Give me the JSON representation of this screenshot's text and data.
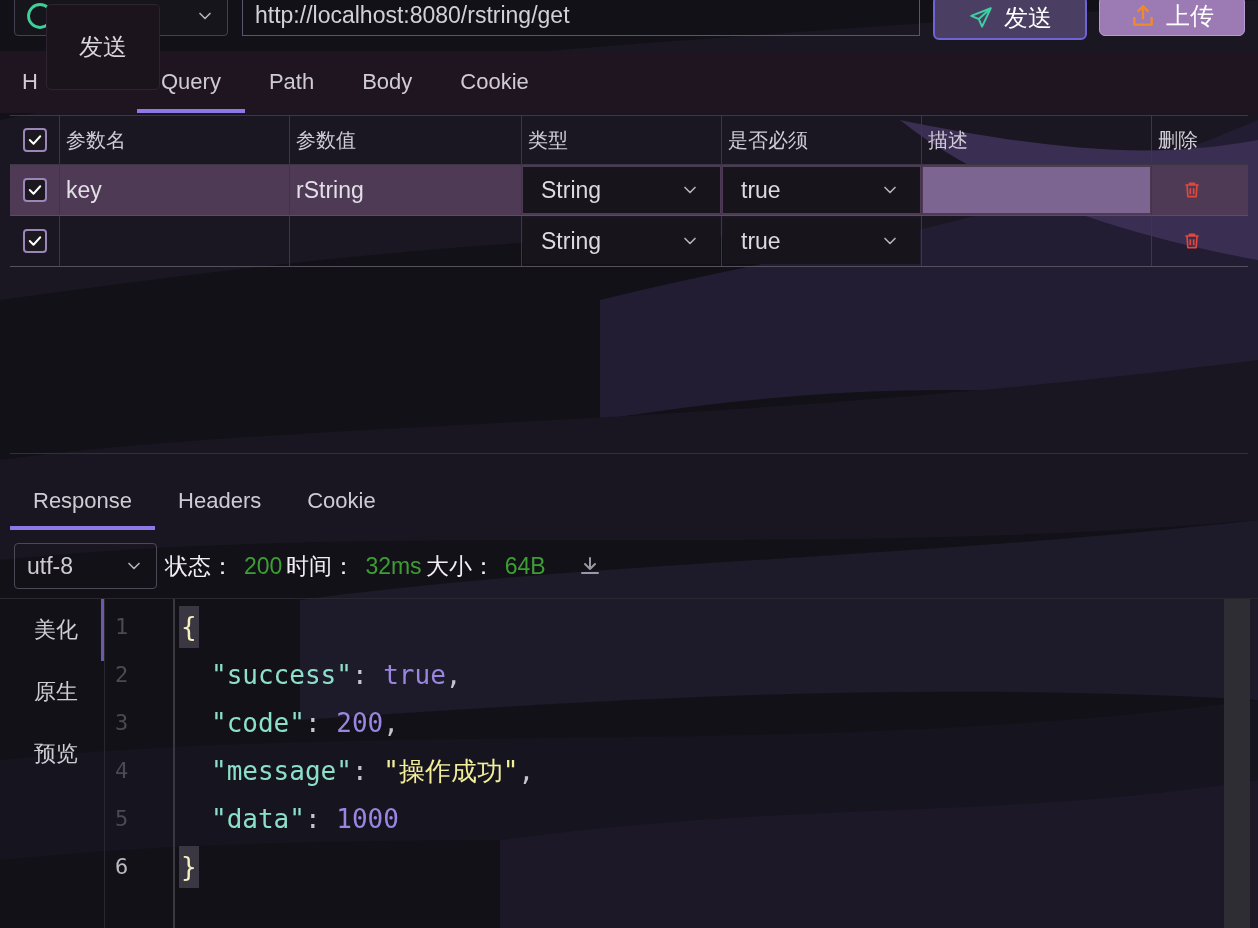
{
  "request_bar": {
    "url": "http://localhost:8080/rstring/get",
    "buttons": [
      {
        "label": "发送",
        "kind": "send"
      },
      {
        "label": "上传",
        "kind": "upload"
      }
    ]
  },
  "tooltip": {
    "text": "发送"
  },
  "request_tabs": [
    {
      "label": "H",
      "selected": false
    },
    {
      "label": "Query",
      "selected": true
    },
    {
      "label": "Path",
      "selected": false
    },
    {
      "label": "Body",
      "selected": false
    },
    {
      "label": "Cookie",
      "selected": false
    }
  ],
  "params_table": {
    "all_checked": true,
    "columns": [
      "参数名",
      "参数值",
      "类型",
      "是否必须",
      "描述",
      "删除"
    ],
    "rows": [
      {
        "checked": true,
        "selected": true,
        "name": "key",
        "value": "rString",
        "type": "String",
        "required": "true"
      },
      {
        "checked": true,
        "selected": false,
        "name": "",
        "value": "",
        "type": "String",
        "required": "true"
      }
    ]
  },
  "response_tabs": [
    {
      "label": "Response",
      "selected": true
    },
    {
      "label": "Headers",
      "selected": false
    },
    {
      "label": "Cookie",
      "selected": false
    }
  ],
  "response_meta": {
    "encoding": "utf-8",
    "items": [
      {
        "label": "状态：",
        "value": "200"
      },
      {
        "label": "时间：",
        "value": "32ms"
      },
      {
        "label": "大小：",
        "value": "64B"
      }
    ]
  },
  "view_modes": [
    {
      "label": "美化",
      "selected": true
    },
    {
      "label": "原生",
      "selected": false
    },
    {
      "label": "预览",
      "selected": false
    }
  ],
  "code": {
    "lines": [
      {
        "number": "1",
        "active": false,
        "tokens": [
          {
            "text": "{",
            "kind": "brace-match"
          }
        ]
      },
      {
        "number": "2",
        "active": false,
        "tokens": [
          {
            "text": "\"success\"",
            "kind": "key"
          },
          {
            "text": ": ",
            "kind": "punct"
          },
          {
            "text": "true",
            "kind": "literal"
          },
          {
            "text": ",",
            "kind": "punct"
          }
        ]
      },
      {
        "number": "3",
        "active": false,
        "tokens": [
          {
            "text": "\"code\"",
            "kind": "key"
          },
          {
            "text": ": ",
            "kind": "punct"
          },
          {
            "text": "200",
            "kind": "literal"
          },
          {
            "text": ",",
            "kind": "punct"
          }
        ]
      },
      {
        "number": "4",
        "active": false,
        "tokens": [
          {
            "text": "\"message\"",
            "kind": "key"
          },
          {
            "text": ": ",
            "kind": "punct"
          },
          {
            "text": "\"操作成功\"",
            "kind": "string"
          },
          {
            "text": ",",
            "kind": "punct"
          }
        ]
      },
      {
        "number": "5",
        "active": false,
        "tokens": [
          {
            "text": "\"data\"",
            "kind": "key"
          },
          {
            "text": ": ",
            "kind": "punct"
          },
          {
            "text": "1000",
            "kind": "literal"
          }
        ]
      },
      {
        "number": "6",
        "active": true,
        "tokens": [
          {
            "text": "}",
            "kind": "brace-match"
          }
        ]
      }
    ]
  }
}
